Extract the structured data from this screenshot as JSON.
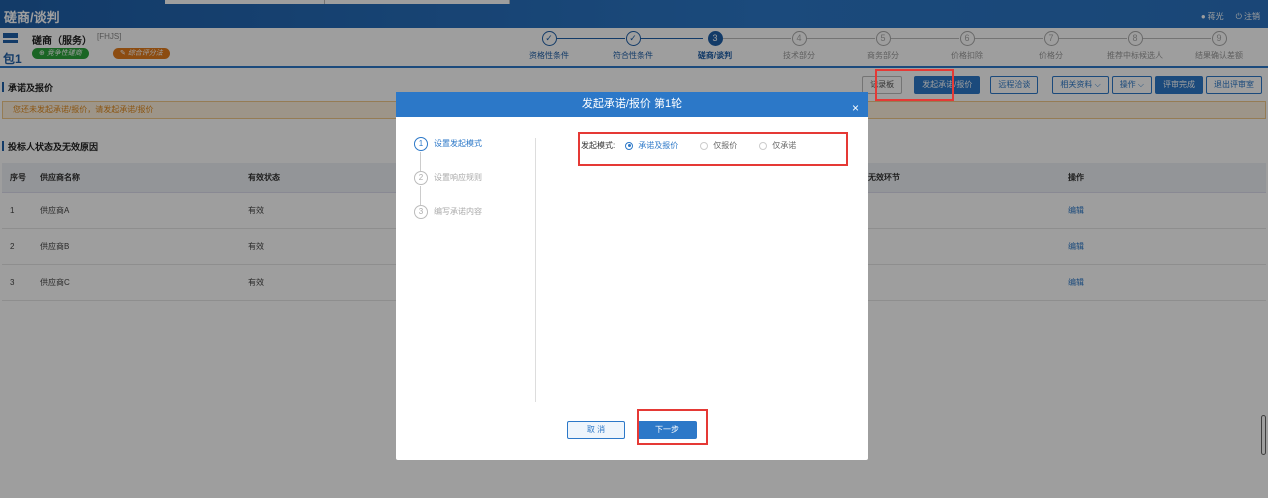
{
  "header": {
    "title": "磋商/谈判",
    "user": "蒋光",
    "logout": "注销"
  },
  "package": {
    "label": "包1",
    "project_title": "磋商（服务）",
    "project_code": "[FHJS]",
    "badge_competitive": "竞争性磋商",
    "badge_scoring": "综合评分法"
  },
  "steps": [
    {
      "num": "✓",
      "label": "资格性条件",
      "state": "done"
    },
    {
      "num": "✓",
      "label": "符合性条件",
      "state": "done"
    },
    {
      "num": "3",
      "label": "磋商/谈判",
      "state": "current"
    },
    {
      "num": "4",
      "label": "技术部分",
      "state": "todo"
    },
    {
      "num": "5",
      "label": "商务部分",
      "state": "todo"
    },
    {
      "num": "6",
      "label": "价格扣除",
      "state": "todo"
    },
    {
      "num": "7",
      "label": "价格分",
      "state": "todo"
    },
    {
      "num": "8",
      "label": "推荐中标候选人",
      "state": "todo"
    },
    {
      "num": "9",
      "label": "结果确认差额",
      "state": "todo"
    }
  ],
  "section1": {
    "title": "承诺及报价",
    "warning": "您还未发起承诺/报价，请发起承诺/报价"
  },
  "toolbar": {
    "notebook": "记录板",
    "start_quote": "发起承诺/报价",
    "remote_negotiation": "远程洽谈",
    "related_docs": "相关资料",
    "operation": "操作",
    "finish_review": "评审完成",
    "exit_room": "退出评审室"
  },
  "section2": {
    "title": "投标人状态及无效原因"
  },
  "table": {
    "headers": [
      "序号",
      "供应商名称",
      "有效状态",
      "无效环节",
      "操作"
    ],
    "rows": [
      {
        "no": "1",
        "name": "供应商A",
        "status": "有效",
        "stage": "",
        "action": "编辑"
      },
      {
        "no": "2",
        "name": "供应商B",
        "status": "有效",
        "stage": "",
        "action": "编辑"
      },
      {
        "no": "3",
        "name": "供应商C",
        "status": "有效",
        "stage": "",
        "action": "编辑"
      }
    ]
  },
  "modal": {
    "title": "发起承诺/报价 第1轮",
    "close": "×",
    "wizard": [
      {
        "num": "1",
        "label": "设置发起模式",
        "state": "active"
      },
      {
        "num": "2",
        "label": "设置响应规则",
        "state": "todo"
      },
      {
        "num": "3",
        "label": "编写承诺内容",
        "state": "todo"
      }
    ],
    "mode_label": "发起模式:",
    "options": [
      {
        "label": "承诺及报价",
        "selected": true
      },
      {
        "label": "仅报价",
        "selected": false
      },
      {
        "label": "仅承诺",
        "selected": false
      }
    ],
    "cancel": "取 消",
    "next": "下一步"
  },
  "colors": {
    "primary": "#2c78c8",
    "header": "#1f5fa8",
    "warning_bg": "#fdf1dd",
    "highlight": "#e53935"
  }
}
